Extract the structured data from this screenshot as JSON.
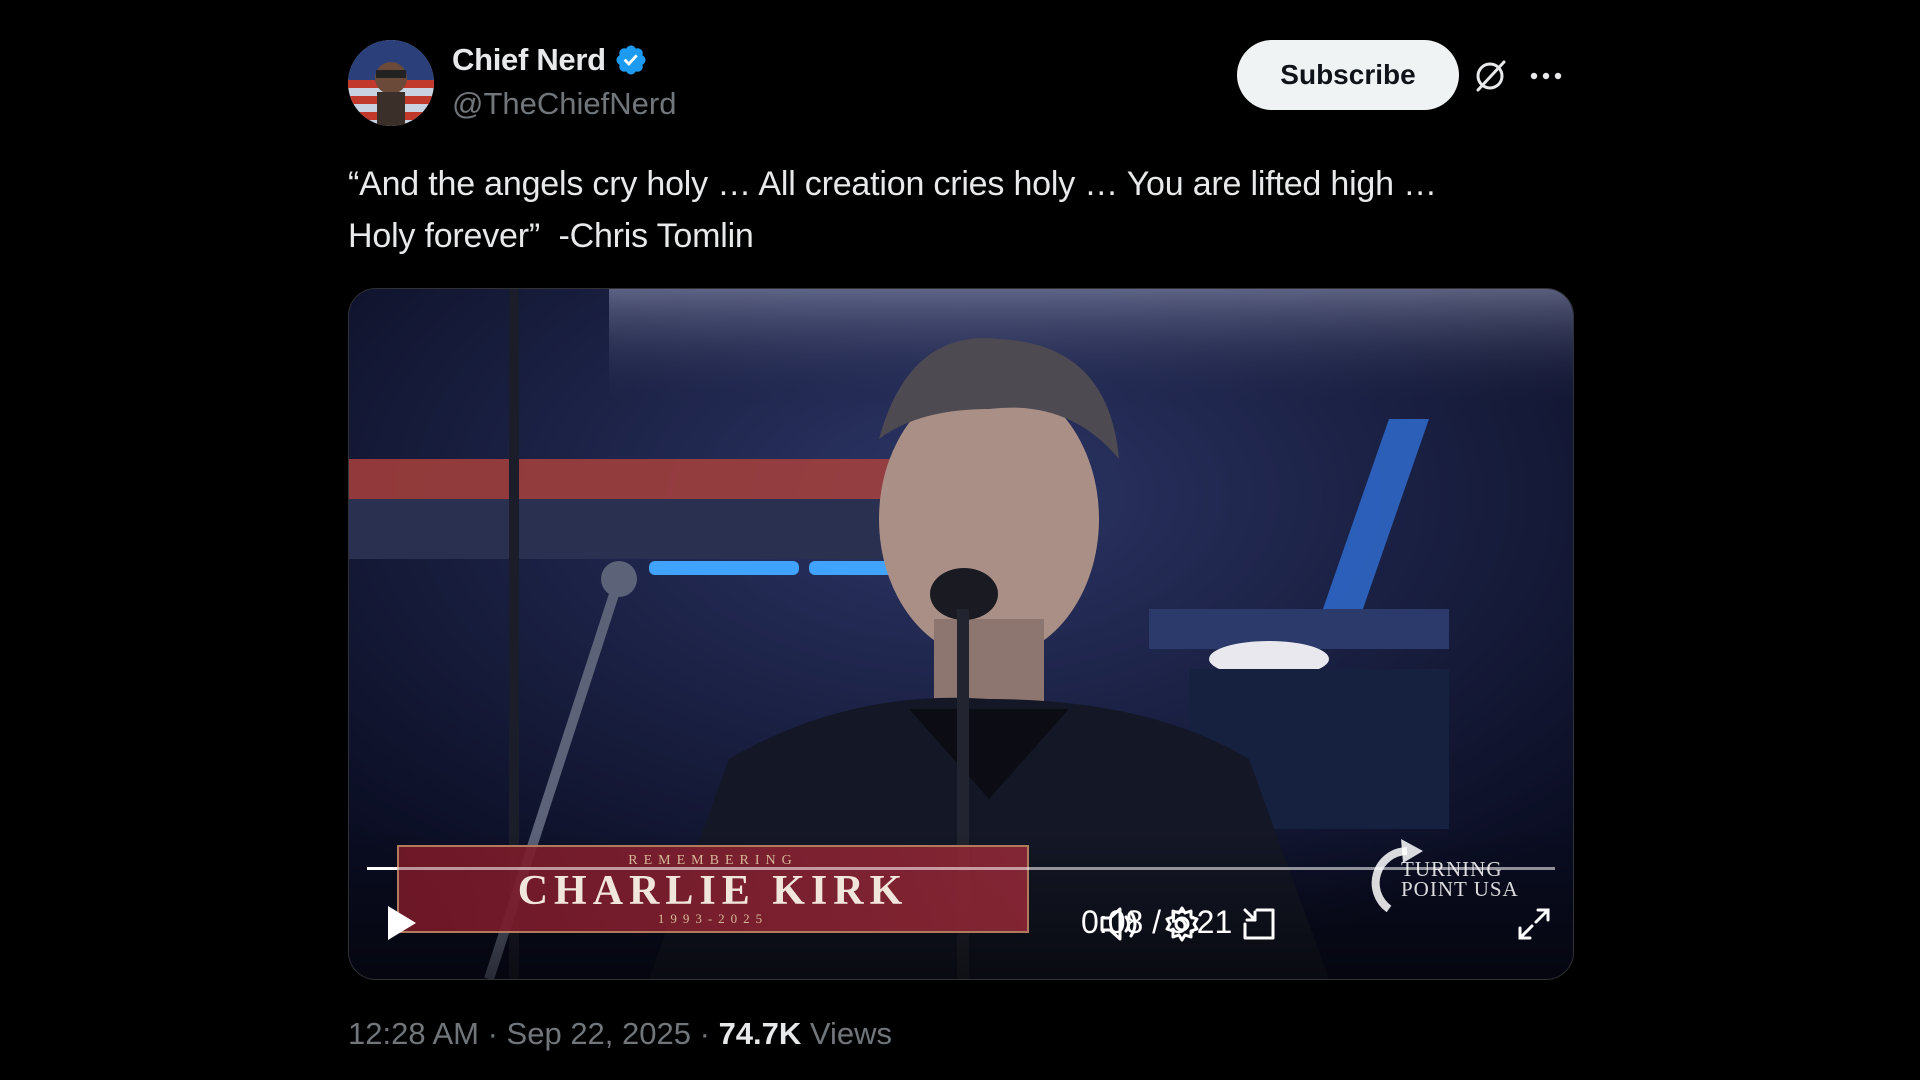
{
  "author": {
    "display_name": "Chief Nerd",
    "handle": "@TheChiefNerd",
    "verified": true
  },
  "actions": {
    "subscribe_label": "Subscribe",
    "grok_icon": "grok-icon",
    "more_icon": "more-icon"
  },
  "tweet": {
    "text": "“And the angels cry holy … All creation cries holy … You are lifted high …\nHoly forever”  -Chris Tomlin"
  },
  "video": {
    "time_display": "0:08 / 5:21",
    "progress_fraction": 0.025,
    "overlay": {
      "banner_top": "REMEMBERING",
      "banner_main": "CHARLIE KIRK",
      "banner_years": "1993-2025",
      "logo_text_line1": "TURNING",
      "logo_text_line2": "POINT USA"
    }
  },
  "meta": {
    "time": "12:28 AM",
    "separator": " · ",
    "date": "Sep 22, 2025",
    "views_count": "74.7K",
    "views_label": " Views"
  },
  "colors": {
    "background": "#000000",
    "text": "#e7e9ea",
    "secondary": "#71767b",
    "verified": "#1d9bf0",
    "subscribe_bg": "#eff3f4"
  }
}
